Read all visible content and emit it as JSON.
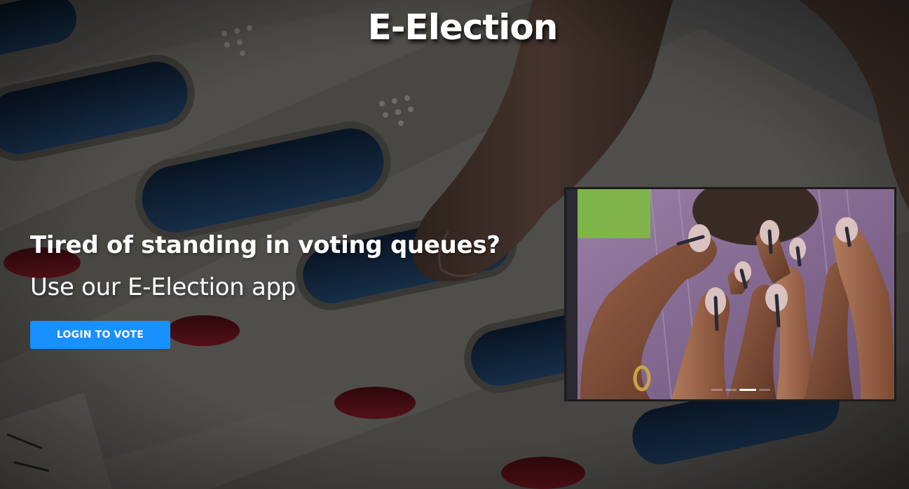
{
  "header": {
    "title": "E-Election"
  },
  "hero": {
    "headline": "Tired of standing in voting queues?",
    "subheadline": "Use our E-Election app",
    "login_button_label": "LOGIN TO VOTE"
  },
  "carousel": {
    "slide_count": 4,
    "active_index": 2,
    "image_subject": "inked-voter-fingers"
  },
  "background": {
    "image_subject": "electronic-voting-machine-finger-press"
  },
  "colors": {
    "primary": "#1890ff",
    "title_text": "#ffffff"
  }
}
